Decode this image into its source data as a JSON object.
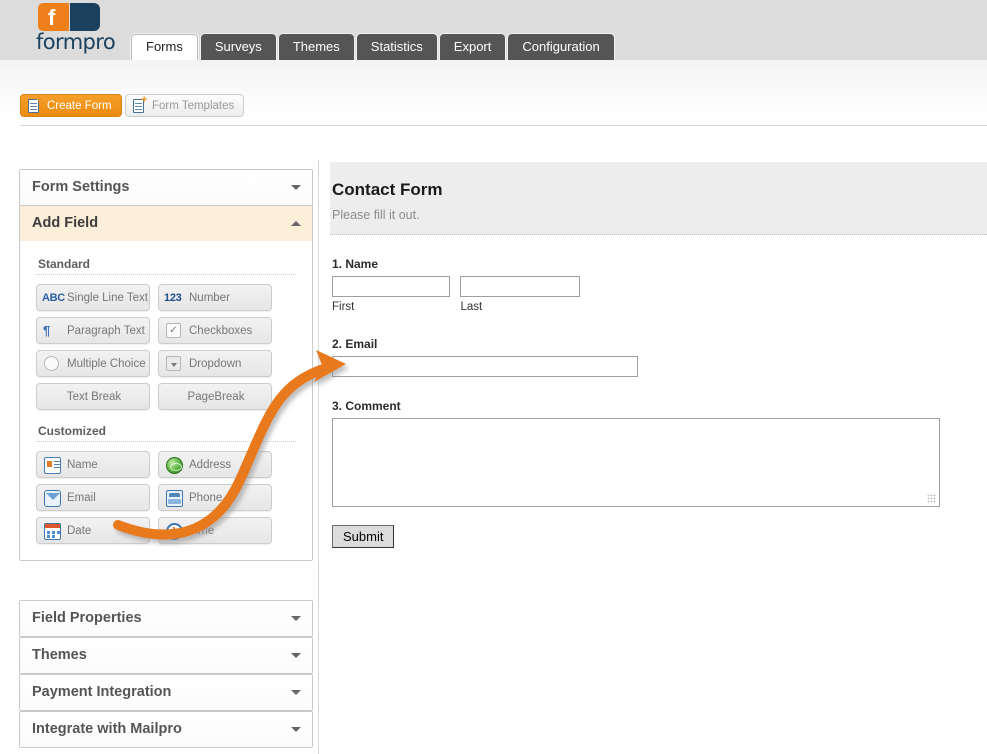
{
  "brand": {
    "name": "formpro",
    "mark": "f",
    "orange": "#ef7f1a",
    "navy": "#1b415e"
  },
  "tabs": [
    {
      "label": "Forms",
      "active": true
    },
    {
      "label": "Surveys",
      "active": false
    },
    {
      "label": "Themes",
      "active": false
    },
    {
      "label": "Statistics",
      "active": false
    },
    {
      "label": "Export",
      "active": false
    },
    {
      "label": "Configuration",
      "active": false
    }
  ],
  "toolbar": {
    "create_label": "Create Form",
    "templates_label": "Form Templates"
  },
  "accordion": [
    {
      "label": "Form Settings",
      "open": false,
      "chevron": "chevron-down-icon"
    },
    {
      "label": "Add Field",
      "open": true,
      "chevron": "chevron-up-icon"
    },
    {
      "label": "Field Properties",
      "open": false,
      "chevron": "chevron-down-icon"
    },
    {
      "label": "Themes",
      "open": false,
      "chevron": "chevron-down-icon"
    },
    {
      "label": "Payment Integration",
      "open": false,
      "chevron": "chevron-down-icon"
    },
    {
      "label": "Integrate with Mailpro",
      "open": false,
      "chevron": "chevron-down-icon"
    }
  ],
  "add_field": {
    "standard_label": "Standard",
    "customized_label": "Customized",
    "standard": [
      {
        "label": "Single Line Text",
        "icon": "abc-icon"
      },
      {
        "label": "Number",
        "icon": "123-icon"
      },
      {
        "label": "Paragraph Text",
        "icon": "pilcrow-icon"
      },
      {
        "label": "Checkboxes",
        "icon": "checkbox-icon"
      },
      {
        "label": "Multiple Choice",
        "icon": "radio-icon"
      },
      {
        "label": "Dropdown",
        "icon": "dropdown-icon"
      },
      {
        "label": "Text Break",
        "icon": ""
      },
      {
        "label": "PageBreak",
        "icon": ""
      }
    ],
    "customized": [
      {
        "label": "Name",
        "icon": "contact-card-icon"
      },
      {
        "label": "Address",
        "icon": "globe-icon"
      },
      {
        "label": "Email",
        "icon": "envelope-icon"
      },
      {
        "label": "Phone",
        "icon": "phone-icon"
      },
      {
        "label": "Date",
        "icon": "calendar-icon"
      },
      {
        "label": "Time",
        "icon": "clock-icon"
      }
    ],
    "icon_glyphs": {
      "abc": "ABC",
      "num": "123",
      "para": "¶",
      "check": "✓"
    }
  },
  "preview": {
    "title": "Contact Form",
    "subtitle": "Please fill it out.",
    "questions": [
      {
        "label": "1. Name",
        "type": "name",
        "value": "",
        "sub": [
          {
            "label": "First",
            "value": ""
          },
          {
            "label": "Last",
            "value": ""
          }
        ]
      },
      {
        "label": "2. Email",
        "type": "text",
        "value": "",
        "sub": []
      },
      {
        "label": "3. Comment",
        "type": "textarea",
        "value": "",
        "sub": []
      }
    ],
    "submit_label": "Submit"
  },
  "annotation": {
    "type": "curved-arrow",
    "color": "#e8791a",
    "from": "customized-field-email-button",
    "to": "preview-email-input"
  }
}
